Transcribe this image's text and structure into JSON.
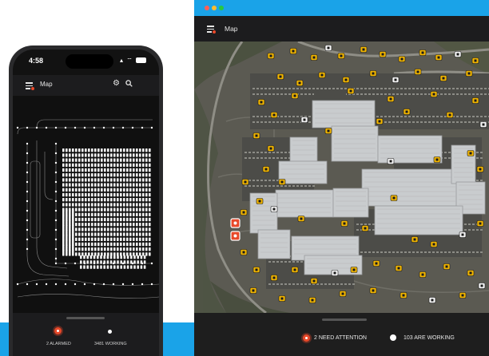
{
  "phone": {
    "status_time": "4:58",
    "status_icons": "▴ ⌔",
    "app_title": "Map",
    "alarmed_label": "2 ALARMED",
    "working_label": "3481 WORKING"
  },
  "window": {
    "app_title": "Map",
    "need_attention_label": "2 NEED ATTENTION",
    "working_label": "103 ARE WORKING"
  },
  "icons": {
    "menu": "menu-icon",
    "settings": "gear-icon",
    "search": "search-icon"
  },
  "colors": {
    "accent_blue": "#1aa3e8",
    "alarm_red": "#e8492a",
    "device_yellow": "#f0b400",
    "app_bar": "#1c1c1e"
  }
}
